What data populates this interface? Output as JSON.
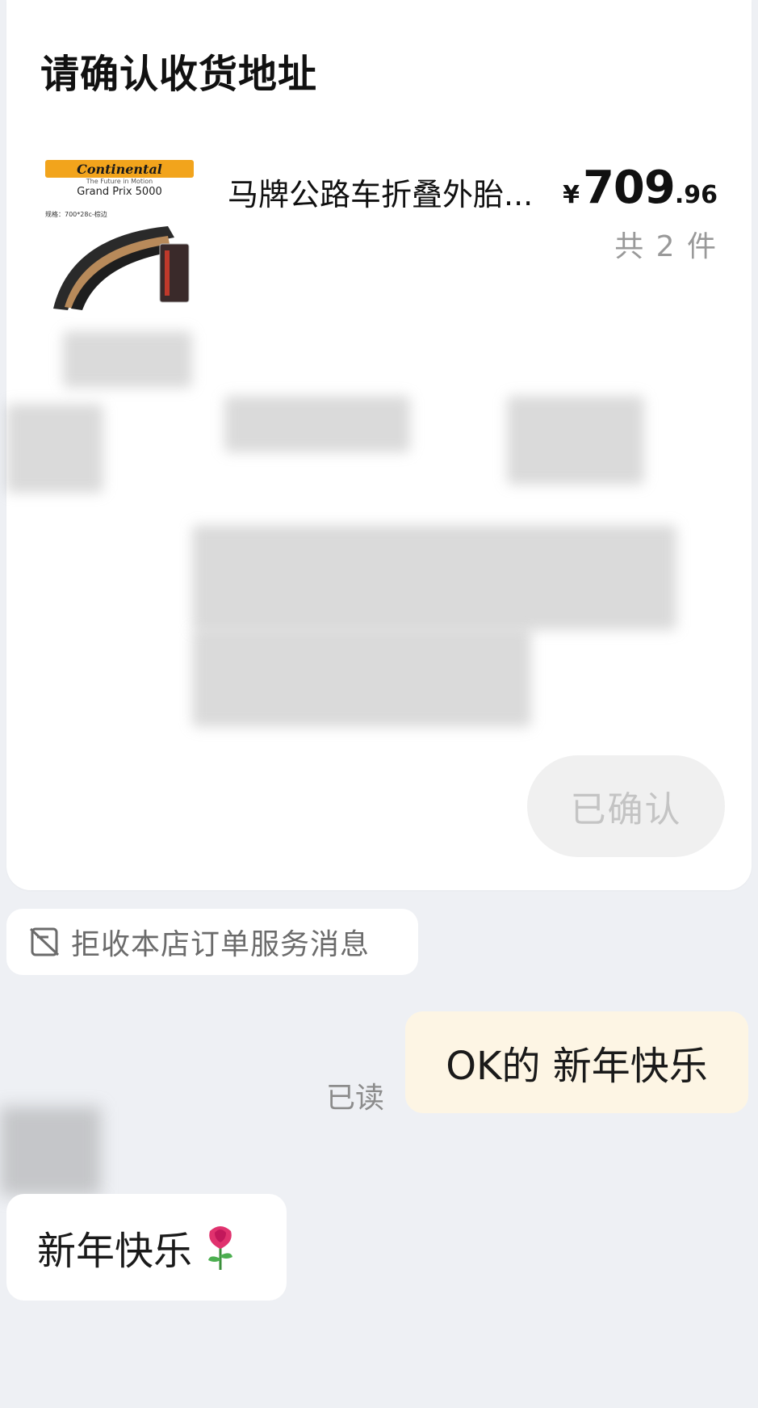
{
  "order_card": {
    "title": "请确认收货地址",
    "product": {
      "title": "马牌公路车折叠外胎...",
      "brand": "Continental",
      "tagline": "The Future in Motion",
      "model": "Grand Prix 5000",
      "spec": "规格：700*28c-棕边",
      "price_symbol": "¥",
      "price_integer": "709",
      "price_decimal": ".96",
      "quantity_text": "共 2 件"
    },
    "confirm_button_label": "已确认"
  },
  "reject_messages": {
    "label": "拒收本店订单服务消息",
    "icon": "message-off-icon"
  },
  "outgoing_message": {
    "text": "OK的 新年快乐",
    "status": "已读"
  },
  "incoming_message": {
    "text": "新年快乐",
    "emoji_icon": "rose-icon"
  },
  "colors": {
    "background": "#eef0f4",
    "outgoing_bubble": "#fdf5e4",
    "brand_strip": "#f2a41c"
  }
}
